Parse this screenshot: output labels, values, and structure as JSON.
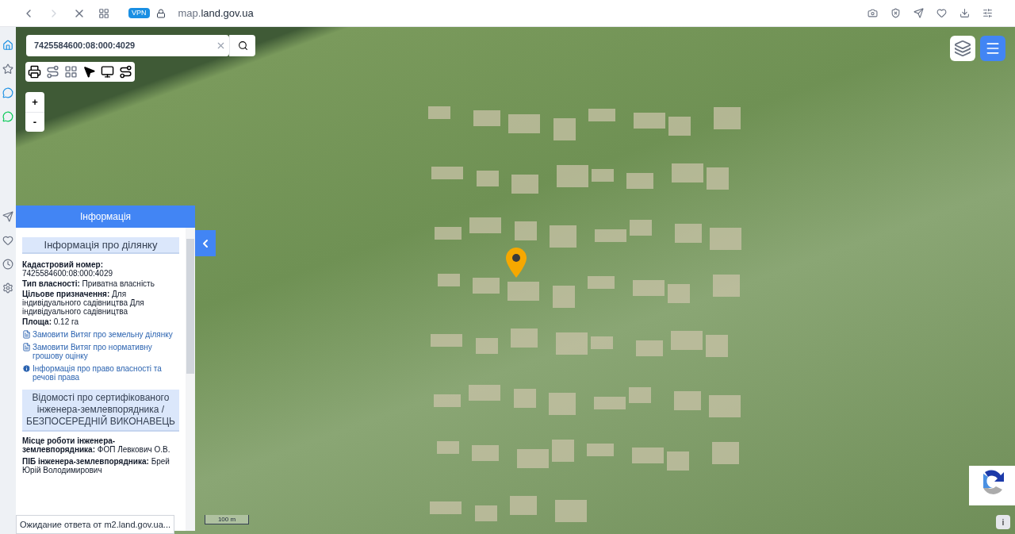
{
  "browser": {
    "vpn_badge": "VPN",
    "url_host": "map.",
    "url_domain": "land.gov.ua"
  },
  "search": {
    "value": "7425584600:08:000:4029"
  },
  "zoom": {
    "plus": "+",
    "minus": "-"
  },
  "panel": {
    "title": "Інформація",
    "section_title": "Інформація про ділянку",
    "fields": [
      {
        "label": "Кадастровий номер:",
        "value": "7425584600:08:000:4029"
      },
      {
        "label": "Тип власності:",
        "value": "Приватна власність"
      },
      {
        "label": "Цільове призначення:",
        "value": "Для індивідуального садівництва Для індивідуального садівництва"
      },
      {
        "label": "Площа:",
        "value": "0.12 га"
      }
    ],
    "links": [
      {
        "kind": "doc",
        "text": "Замовити Витяг про земельну ділянку"
      },
      {
        "kind": "doc",
        "text": "Замовити Витяг про нормативну грошову оцінку"
      },
      {
        "kind": "info",
        "text": "Інформація про право власності та речові права"
      }
    ],
    "engineer_title": "Відомості про сертифікованого інженера-землевпорядника / БЕЗПОСЕРЕДНІЙ ВИКОНАВЕЦЬ",
    "engineer_fields": [
      {
        "label": "Місце роботи інженера-землевпорядника:",
        "value": "ФОП Левкович О.В."
      },
      {
        "label": "ПІБ інженера-землевпорядника:",
        "value": "Брей Юрій Володимирович"
      }
    ]
  },
  "scale": "100 m",
  "status_text": "Ожидание ответа от m2.land.gov.ua...",
  "info_button": "i"
}
